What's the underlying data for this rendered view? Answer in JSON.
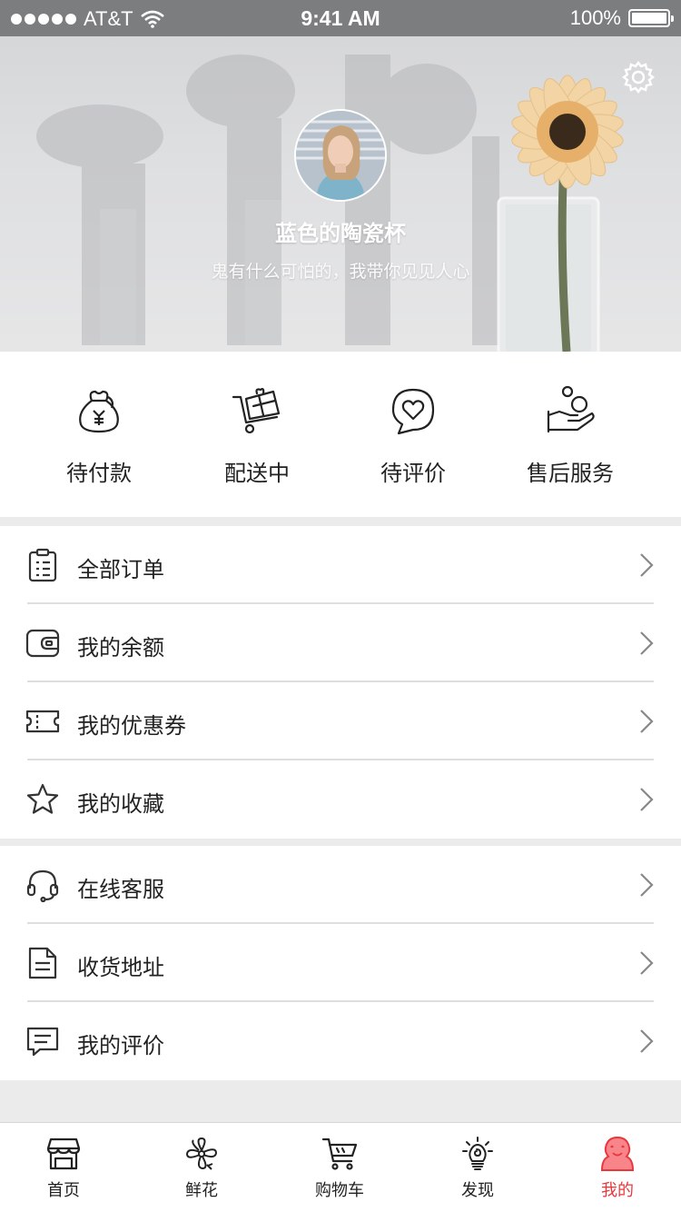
{
  "status_bar": {
    "carrier": "AT&T",
    "time": "9:41 AM",
    "battery": "100%"
  },
  "profile": {
    "name": "蓝色的陶瓷杯",
    "bio": "鬼有什么可怕的，我带你见见人心"
  },
  "order_shortcuts": [
    {
      "label": "待付款",
      "icon": "money-bag-icon"
    },
    {
      "label": "配送中",
      "icon": "delivery-cart-icon"
    },
    {
      "label": "待评价",
      "icon": "heart-chat-icon"
    },
    {
      "label": "售后服务",
      "icon": "hand-service-icon"
    }
  ],
  "menu_group_1": [
    {
      "label": "全部订单",
      "icon": "clipboard-icon"
    },
    {
      "label": "我的余额",
      "icon": "wallet-icon"
    },
    {
      "label": "我的优惠券",
      "icon": "coupon-icon"
    },
    {
      "label": "我的收藏",
      "icon": "star-icon"
    }
  ],
  "menu_group_2": [
    {
      "label": "在线客服",
      "icon": "headset-icon"
    },
    {
      "label": "收货地址",
      "icon": "document-icon"
    },
    {
      "label": "我的评价",
      "icon": "comment-icon"
    }
  ],
  "tabs": [
    {
      "label": "首页",
      "icon": "store-icon"
    },
    {
      "label": "鲜花",
      "icon": "flower-icon"
    },
    {
      "label": "购物车",
      "icon": "cart-icon"
    },
    {
      "label": "发现",
      "icon": "lightbulb-icon"
    },
    {
      "label": "我的",
      "icon": "person-icon",
      "active": true
    }
  ],
  "colors": {
    "accent": "#e8383d",
    "text": "#222222",
    "divider": "#dedede",
    "background": "#ebebeb"
  }
}
